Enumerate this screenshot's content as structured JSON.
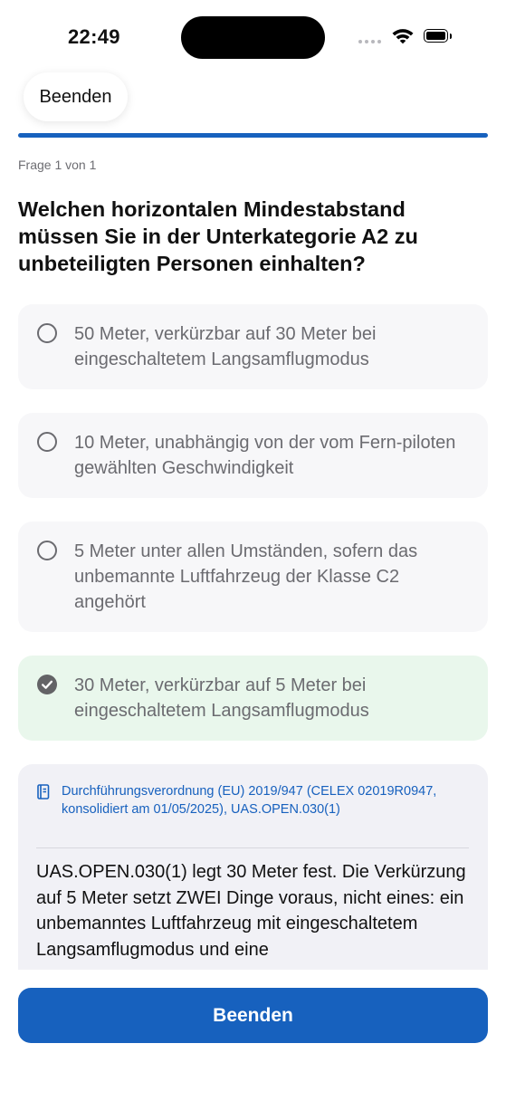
{
  "status_bar": {
    "time": "22:49"
  },
  "header": {
    "close_label": "Beenden"
  },
  "progress": {
    "value": 1.0,
    "counter_text": "Frage 1 von 1"
  },
  "question": {
    "text": "Welchen horizontalen Mindestabstand müssen Sie in der Unterkategorie A2 zu unbeteiligten Personen einhalten?"
  },
  "options": [
    {
      "text": "50 Meter, verkürzbar auf 30 Meter bei eingeschaltetem Langsamflugmodus",
      "state": "unselected"
    },
    {
      "text": "10 Meter, unabhängig von der vom Fern-piloten gewählten Geschwindigkeit",
      "state": "unselected"
    },
    {
      "text": "5 Meter unter allen Umständen, sofern das unbemannte Luftfahrzeug der Klasse C2 angehört",
      "state": "unselected"
    },
    {
      "text": "30 Meter, verkürzbar auf 5 Meter bei eingeschaltetem Langsamflugmodus",
      "state": "correct"
    }
  ],
  "explanation": {
    "reference": "Durchführungsverordnung (EU) 2019/947 (CELEX 02019R0947, konsolidiert am 01/05/2025), UAS.OPEN.030(1)",
    "text": "UAS.OPEN.030(1) legt 30 Meter fest. Die Verkürzung auf 5 Meter setzt ZWEI Dinge voraus, nicht eines: ein unbemanntes Luftfahrzeug mit eingeschaltetem Langsamflugmodus und eine"
  },
  "footer": {
    "button_label": "Beenden"
  },
  "colors": {
    "accent": "#1761be",
    "correct_bg": "#e9f7ec",
    "option_bg": "#f7f7f9",
    "explanation_bg": "#f1f1f6"
  },
  "icons": {
    "reference": "book-icon",
    "correct": "checkmark-circle-icon",
    "unselected": "radio-empty-icon"
  }
}
